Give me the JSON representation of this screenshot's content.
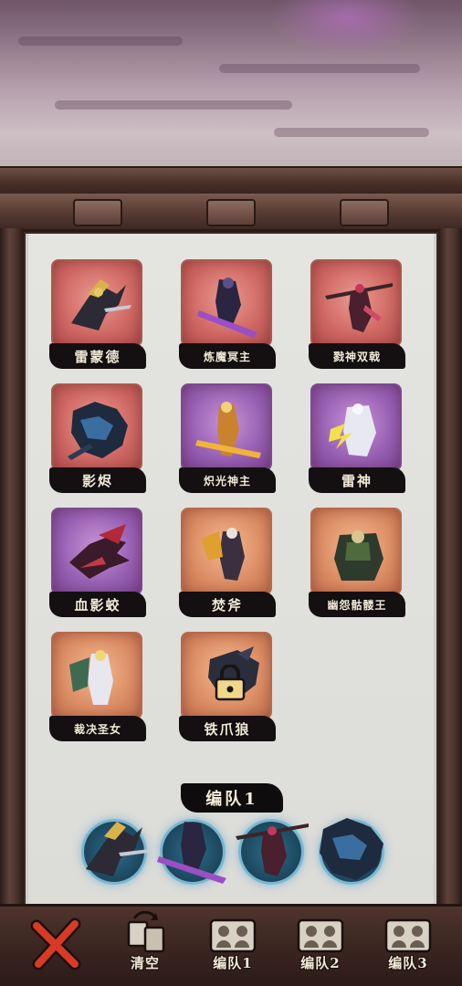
{
  "heroes": [
    {
      "name": "雷蒙德",
      "bg": "red",
      "art": "gold-lancer-rider"
    },
    {
      "name": "炼魔冥主",
      "bg": "red",
      "art": "dark-sword-lord"
    },
    {
      "name": "戮神双戟",
      "bg": "red",
      "art": "twin-halberd-warrior"
    },
    {
      "name": "影烬",
      "bg": "red",
      "art": "shadow-beast"
    },
    {
      "name": "炽光神主",
      "bg": "purple",
      "art": "radiant-god"
    },
    {
      "name": "雷神",
      "bg": "purple",
      "art": "thunder-god"
    },
    {
      "name": "血影蛟",
      "bg": "purple",
      "art": "blood-dragon"
    },
    {
      "name": "焚斧",
      "bg": "orange",
      "art": "flame-axe"
    },
    {
      "name": "幽怨骷髅王",
      "bg": "orange",
      "art": "skeleton-king"
    },
    {
      "name": "裁决圣女",
      "bg": "orange",
      "art": "judgment-saint"
    },
    {
      "name": "铁爪狼",
      "bg": "orange",
      "art": "iron-claw-wolf",
      "locked": true
    }
  ],
  "team": {
    "title": "编队1",
    "slots": [
      "雷蒙德",
      "炼魔冥主",
      "戮神双戟",
      "影烬"
    ]
  },
  "toolbar": {
    "close_icon": "red-x-icon",
    "clear_label": "清空",
    "team1_label": "编队1",
    "team2_label": "编队2",
    "team3_label": "编队3"
  },
  "colors": {
    "red_card": "#d16a65",
    "purple_card": "#9a62b5",
    "orange_card": "#dd8f66",
    "nameplate": "#141012",
    "slot_glow": "#50aad2",
    "frame_wood": "#4a3029"
  }
}
